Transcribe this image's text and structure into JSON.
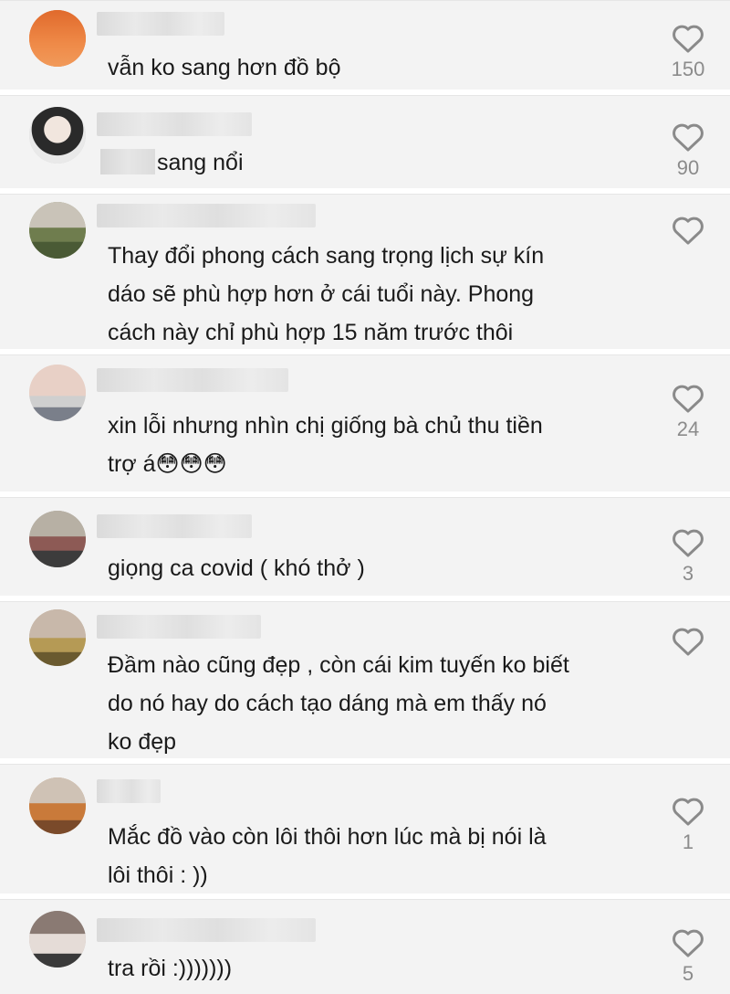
{
  "comments": [
    {
      "text": "vẫn ko sang hơn đồ bộ",
      "likes": "150"
    },
    {
      "text": "sang nổi",
      "likes": "90"
    },
    {
      "text": "Thay đổi phong cách sang trọng lịch sự kín\ndáo sẽ phù hợp hơn ở cái tuổi này. Phong\ncách này chỉ phù hợp 15 năm trước thôi",
      "likes": ""
    },
    {
      "text": "xin lỗi nhưng nhìn chị giống bà chủ thu tiền\ntrợ á😳😳😳",
      "likes": "24"
    },
    {
      "text": "giọng ca covid ( khó thở )",
      "likes": "3"
    },
    {
      "text": "Đầm nào cũng đẹp , còn cái kim tuyến ko biết\ndo nó hay do cách tạo dáng mà em thấy nó\nko đẹp",
      "likes": ""
    },
    {
      "text": "Mắc đồ vào còn lôi thôi hơn lúc mà bị nói là\nlôi thôi : ))",
      "likes": "1"
    },
    {
      "text": "tra rồi :)))))))",
      "likes": "5"
    }
  ],
  "icons": {
    "like": "heart-outline-icon"
  },
  "colors": {
    "card_bg": "#f3f3f3",
    "text": "#1a1a1a",
    "count": "#8b8b8b"
  }
}
